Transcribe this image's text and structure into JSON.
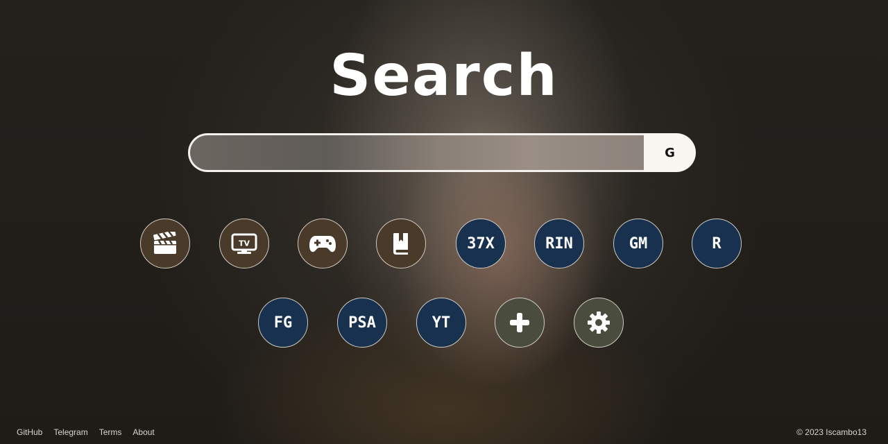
{
  "page": {
    "title": "Search"
  },
  "search": {
    "value": "",
    "placeholder": "",
    "button_label": "G"
  },
  "shortcuts": {
    "row1": [
      {
        "label": "",
        "icon": "clapperboard-icon",
        "style": "brown"
      },
      {
        "label": "TV",
        "icon": "tv-icon",
        "style": "brown"
      },
      {
        "label": "",
        "icon": "gamepad-icon",
        "style": "brown"
      },
      {
        "label": "",
        "icon": "book-icon",
        "style": "brown"
      },
      {
        "label": "37X",
        "style": "blue"
      },
      {
        "label": "RIN",
        "style": "blue"
      },
      {
        "label": "GM",
        "style": "blue"
      },
      {
        "label": "R",
        "style": "blue"
      }
    ],
    "row2": [
      {
        "label": "FG",
        "style": "blue"
      },
      {
        "label": "PSA",
        "style": "blue"
      },
      {
        "label": "YT",
        "style": "blue"
      },
      {
        "label": "",
        "icon": "plus-icon",
        "style": "olive"
      },
      {
        "label": "",
        "icon": "gear-icon",
        "style": "olive"
      }
    ]
  },
  "footer": {
    "links": [
      "GitHub",
      "Telegram",
      "Terms",
      "About"
    ],
    "copyright": "© 2023 Iscambo13"
  },
  "colors": {
    "circle_brown": "#4a3a2a",
    "circle_blue": "#17314f",
    "circle_olive": "#4a4c3e",
    "search_button_bg": "#faf7f2"
  }
}
